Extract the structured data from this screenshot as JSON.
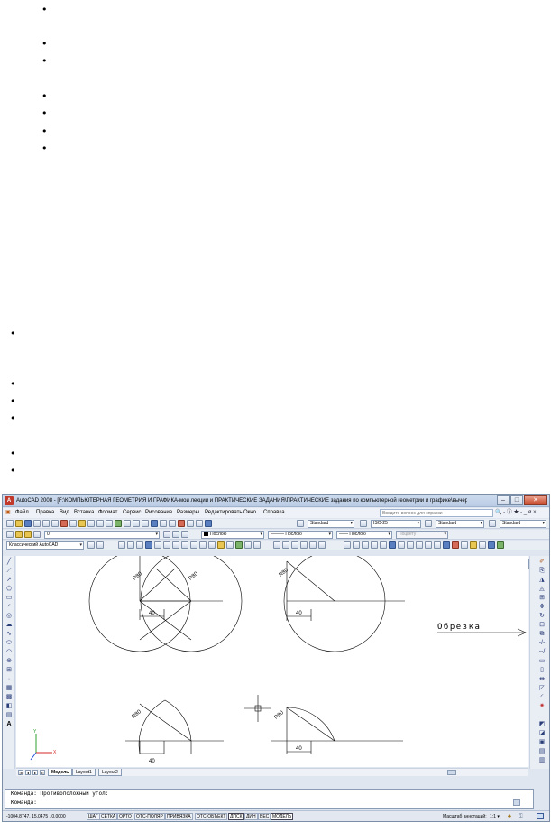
{
  "document": {
    "bullets": [
      "•",
      "•",
      "•",
      "•",
      "•",
      "•",
      "•",
      "•",
      "•",
      "•",
      "•",
      "•",
      "•"
    ]
  },
  "window": {
    "title": "AutoCAD 2008 - [F:\\КОМПЬЮТЕРНАЯ ГЕОМЕТРИЯ И ГРАФИКА-мои лекции и ПРАКТИЧЕСКИЕ ЗАДАНИЯ\\ПРАКТИЧЕСКИЕ задания по компьютерной геометрии и графике\\вычерчивание и]",
    "app_icon": "A",
    "buttons": {
      "minimize": "–",
      "maximize": "□",
      "close": "✕"
    }
  },
  "menubar": {
    "items": [
      "Файл",
      "Правка",
      "Вид",
      "Вставка",
      "Формат",
      "Сервис",
      "Рисование",
      "Размеры",
      "Редактировать",
      "Окно",
      "Справка"
    ],
    "help_placeholder": "Введите вопрос для справки",
    "right_tools": "🔍 - ⓘ ★ - _ ø ×"
  },
  "toolbars": {
    "text_style": "Standard",
    "dim_style": "ISO-25",
    "table_style": "Standard",
    "multileader_style": "Standard",
    "layer": "0",
    "workspace": "Классический AutoCAD",
    "color": "Послою",
    "linetype": "Послою",
    "lineweight": "Послою",
    "plotstyle": "Поцвету"
  },
  "drawing": {
    "labels": {
      "r1": "R80",
      "r2": "R80",
      "r3": "R80",
      "r4": "R80",
      "r5": "R80",
      "dim_a": "40",
      "dim_b": "40",
      "dim_c": "40",
      "dim_d": "40",
      "trim_label": "Обрезка"
    },
    "ucs": {
      "y": "Y",
      "x": "X"
    }
  },
  "tabs": {
    "nav": [
      "|◂",
      "◂",
      "▸",
      "▸|"
    ],
    "items": [
      "Модель",
      "Layout1",
      "Layout2"
    ]
  },
  "command": {
    "line1": "Команда: Противоположный угол:",
    "line2": "Команда:"
  },
  "status": {
    "coordinates": "-1004.8747, 15.0475 , 0.0000",
    "buttons": [
      "ШАГ",
      "СЕТКА",
      "ОРТО",
      "ОТС-ПОЛЯР",
      "ПРИВЯЗКА",
      "ОТС-ОБЪЕКТ",
      "ДПСК",
      "ДИН",
      "ВЕС",
      "МОДЕЛЬ"
    ],
    "annotation_scale_label": "Масштаб аннотаций:",
    "annotation_scale_value": "1:1 ▾"
  },
  "colors": {
    "title_bar": "#b9cbe4",
    "canvas": "#ffffff",
    "ucs_y": "#2ca02c",
    "ucs_x": "#d62728",
    "ucs_z": "#1f4fd6"
  }
}
